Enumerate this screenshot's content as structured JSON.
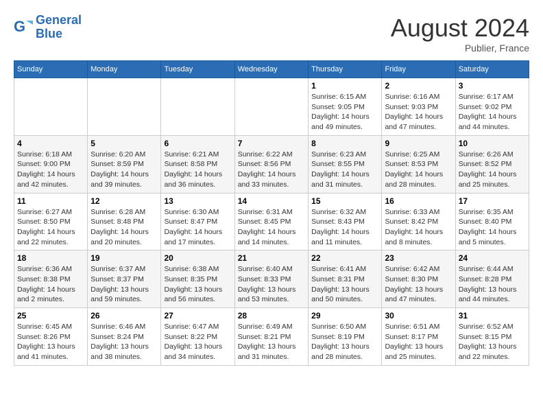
{
  "header": {
    "logo_line1": "General",
    "logo_line2": "Blue",
    "month_year": "August 2024",
    "location": "Publier, France"
  },
  "days_of_week": [
    "Sunday",
    "Monday",
    "Tuesday",
    "Wednesday",
    "Thursday",
    "Friday",
    "Saturday"
  ],
  "weeks": [
    [
      {
        "day": "",
        "info": ""
      },
      {
        "day": "",
        "info": ""
      },
      {
        "day": "",
        "info": ""
      },
      {
        "day": "",
        "info": ""
      },
      {
        "day": "1",
        "info": "Sunrise: 6:15 AM\nSunset: 9:05 PM\nDaylight: 14 hours and 49 minutes."
      },
      {
        "day": "2",
        "info": "Sunrise: 6:16 AM\nSunset: 9:03 PM\nDaylight: 14 hours and 47 minutes."
      },
      {
        "day": "3",
        "info": "Sunrise: 6:17 AM\nSunset: 9:02 PM\nDaylight: 14 hours and 44 minutes."
      }
    ],
    [
      {
        "day": "4",
        "info": "Sunrise: 6:18 AM\nSunset: 9:00 PM\nDaylight: 14 hours and 42 minutes."
      },
      {
        "day": "5",
        "info": "Sunrise: 6:20 AM\nSunset: 8:59 PM\nDaylight: 14 hours and 39 minutes."
      },
      {
        "day": "6",
        "info": "Sunrise: 6:21 AM\nSunset: 8:58 PM\nDaylight: 14 hours and 36 minutes."
      },
      {
        "day": "7",
        "info": "Sunrise: 6:22 AM\nSunset: 8:56 PM\nDaylight: 14 hours and 33 minutes."
      },
      {
        "day": "8",
        "info": "Sunrise: 6:23 AM\nSunset: 8:55 PM\nDaylight: 14 hours and 31 minutes."
      },
      {
        "day": "9",
        "info": "Sunrise: 6:25 AM\nSunset: 8:53 PM\nDaylight: 14 hours and 28 minutes."
      },
      {
        "day": "10",
        "info": "Sunrise: 6:26 AM\nSunset: 8:52 PM\nDaylight: 14 hours and 25 minutes."
      }
    ],
    [
      {
        "day": "11",
        "info": "Sunrise: 6:27 AM\nSunset: 8:50 PM\nDaylight: 14 hours and 22 minutes."
      },
      {
        "day": "12",
        "info": "Sunrise: 6:28 AM\nSunset: 8:48 PM\nDaylight: 14 hours and 20 minutes."
      },
      {
        "day": "13",
        "info": "Sunrise: 6:30 AM\nSunset: 8:47 PM\nDaylight: 14 hours and 17 minutes."
      },
      {
        "day": "14",
        "info": "Sunrise: 6:31 AM\nSunset: 8:45 PM\nDaylight: 14 hours and 14 minutes."
      },
      {
        "day": "15",
        "info": "Sunrise: 6:32 AM\nSunset: 8:43 PM\nDaylight: 14 hours and 11 minutes."
      },
      {
        "day": "16",
        "info": "Sunrise: 6:33 AM\nSunset: 8:42 PM\nDaylight: 14 hours and 8 minutes."
      },
      {
        "day": "17",
        "info": "Sunrise: 6:35 AM\nSunset: 8:40 PM\nDaylight: 14 hours and 5 minutes."
      }
    ],
    [
      {
        "day": "18",
        "info": "Sunrise: 6:36 AM\nSunset: 8:38 PM\nDaylight: 14 hours and 2 minutes."
      },
      {
        "day": "19",
        "info": "Sunrise: 6:37 AM\nSunset: 8:37 PM\nDaylight: 13 hours and 59 minutes."
      },
      {
        "day": "20",
        "info": "Sunrise: 6:38 AM\nSunset: 8:35 PM\nDaylight: 13 hours and 56 minutes."
      },
      {
        "day": "21",
        "info": "Sunrise: 6:40 AM\nSunset: 8:33 PM\nDaylight: 13 hours and 53 minutes."
      },
      {
        "day": "22",
        "info": "Sunrise: 6:41 AM\nSunset: 8:31 PM\nDaylight: 13 hours and 50 minutes."
      },
      {
        "day": "23",
        "info": "Sunrise: 6:42 AM\nSunset: 8:30 PM\nDaylight: 13 hours and 47 minutes."
      },
      {
        "day": "24",
        "info": "Sunrise: 6:44 AM\nSunset: 8:28 PM\nDaylight: 13 hours and 44 minutes."
      }
    ],
    [
      {
        "day": "25",
        "info": "Sunrise: 6:45 AM\nSunset: 8:26 PM\nDaylight: 13 hours and 41 minutes."
      },
      {
        "day": "26",
        "info": "Sunrise: 6:46 AM\nSunset: 8:24 PM\nDaylight: 13 hours and 38 minutes."
      },
      {
        "day": "27",
        "info": "Sunrise: 6:47 AM\nSunset: 8:22 PM\nDaylight: 13 hours and 34 minutes."
      },
      {
        "day": "28",
        "info": "Sunrise: 6:49 AM\nSunset: 8:21 PM\nDaylight: 13 hours and 31 minutes."
      },
      {
        "day": "29",
        "info": "Sunrise: 6:50 AM\nSunset: 8:19 PM\nDaylight: 13 hours and 28 minutes."
      },
      {
        "day": "30",
        "info": "Sunrise: 6:51 AM\nSunset: 8:17 PM\nDaylight: 13 hours and 25 minutes."
      },
      {
        "day": "31",
        "info": "Sunrise: 6:52 AM\nSunset: 8:15 PM\nDaylight: 13 hours and 22 minutes."
      }
    ]
  ]
}
